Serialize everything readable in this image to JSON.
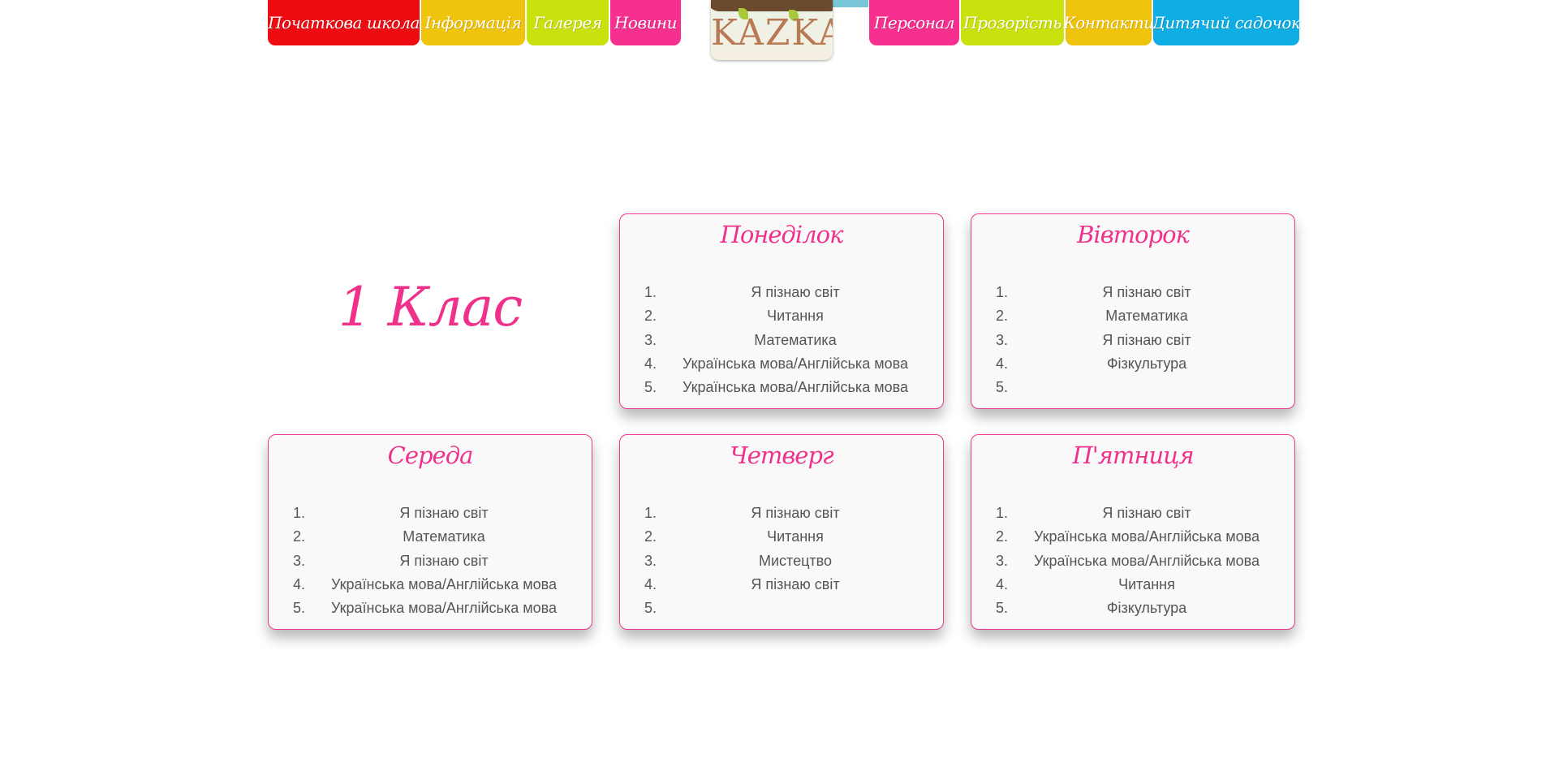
{
  "nav": {
    "left": [
      {
        "label": "Початкова школа",
        "color": "#ee0c12"
      },
      {
        "label": "Інформація",
        "color": "#f0c30c"
      },
      {
        "label": "Галерея",
        "color": "#c9e20e"
      },
      {
        "label": "Новини",
        "color": "#f72f8e"
      }
    ],
    "logo_text": "KAZKA",
    "right": [
      {
        "label": "Персонал",
        "color": "#f72f8e"
      },
      {
        "label": "Прозорість",
        "color": "#c9e20e"
      },
      {
        "label": "Контакти",
        "color": "#f0c30c"
      },
      {
        "label": "Дитячий садочок",
        "color": "#0eaee4"
      }
    ]
  },
  "class_title": "1 Клас",
  "accent_color": "#f0318c",
  "days": [
    {
      "title": "Понеділок",
      "lessons": [
        "Я пізнаю світ",
        "Читання",
        "Математика",
        "Українська мова/Англійська мова",
        "Українська мова/Англійська мова"
      ]
    },
    {
      "title": "Вівторок",
      "lessons": [
        "Я пізнаю світ",
        "Математика",
        "Я пізнаю світ",
        "Фізкультура",
        ""
      ]
    },
    {
      "title": "Середа",
      "lessons": [
        "Я пізнаю світ",
        "Математика",
        "Я пізнаю світ",
        "Українська мова/Англійська мова",
        "Українська мова/Англійська мова"
      ]
    },
    {
      "title": "Четверг",
      "lessons": [
        "Я пізнаю світ",
        "Читання",
        "Мистецтво",
        "Я пізнаю світ",
        ""
      ]
    },
    {
      "title": "П'ятниця",
      "lessons": [
        "Я пізнаю світ",
        "Українська мова/Англійська мова",
        "Українська мова/Англійська мова",
        "Читання",
        "Фізкультура"
      ]
    }
  ],
  "numbers": [
    "1.",
    "2.",
    "3.",
    "4.",
    "5."
  ]
}
